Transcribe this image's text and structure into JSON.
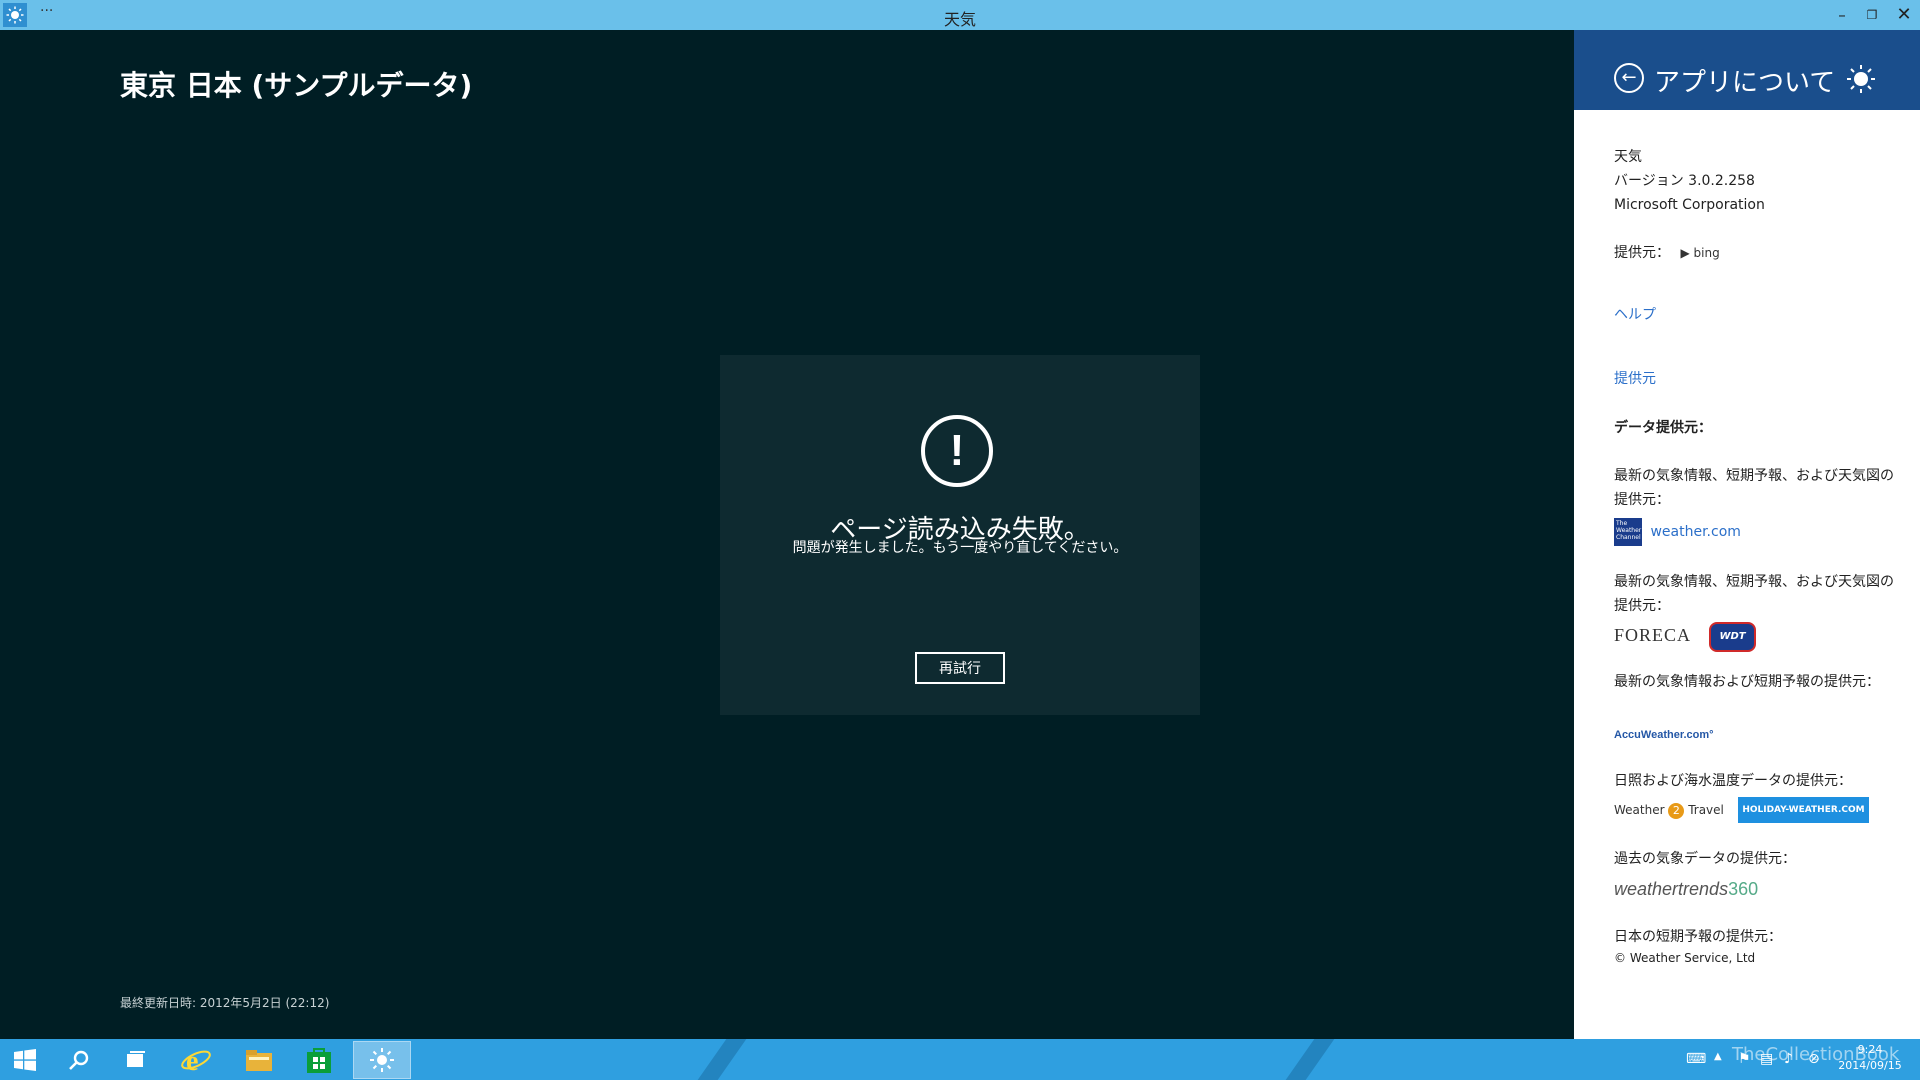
{
  "window": {
    "title": "天気",
    "menu_label": "···"
  },
  "main": {
    "city_title": "東京 日本 (サンプルデータ)",
    "error": {
      "icon_glyph": "!",
      "title": "ページ読み込み失敗。",
      "message": "問題が発生しました。もう一度やり直してください。",
      "retry_label": "再試行"
    },
    "last_updated": "最終更新日時: 2012年5月2日 (22:12)"
  },
  "panel": {
    "title": "アプリについて",
    "back_glyph": "←",
    "app_name": "天気",
    "version": "バージョン 3.0.2.258",
    "publisher": "Microsoft Corporation",
    "powered_by_label": "提供元：",
    "powered_by_brand": "bing",
    "help_link": "ヘルプ",
    "credits_link": "提供元",
    "data_providers_heading": "データ提供元：",
    "providers": [
      {
        "desc": "最新の気象情報、短期予報、および天気図の提供元：",
        "logo": "weather.com",
        "logo_badge": "The Weather Channel"
      },
      {
        "desc": "最新の気象情報、短期予報、および天気図の提供元：",
        "logo": "FORECA",
        "logo2": "WDT"
      },
      {
        "desc": "最新の気象情報および短期予報の提供元：",
        "logo": "AccuWeather.com°"
      },
      {
        "desc": "日照および海水温度データの提供元：",
        "logo": "Weather",
        "logo_mid": "2",
        "logo_end": "Travel",
        "logo2": "HOLIDAY-WEATHER.COM"
      },
      {
        "desc": "過去の気象データの提供元：",
        "logo": "weathertrends",
        "logo_num": "360"
      },
      {
        "desc": "日本の短期予報の提供元：",
        "logo": "© Weather Service, Ltd"
      }
    ]
  },
  "taskbar": {
    "clock_time": "9:24",
    "clock_date": "2014/09/15",
    "watermark": "TheCollectionBook"
  },
  "colors": {
    "titlebar": "#6ac0ea",
    "app_background": "#001e24",
    "error_card": "#0e2a30",
    "panel_header": "#1a4e8c",
    "taskbar": "#2f9fe0",
    "link": "#2b6fc9"
  }
}
